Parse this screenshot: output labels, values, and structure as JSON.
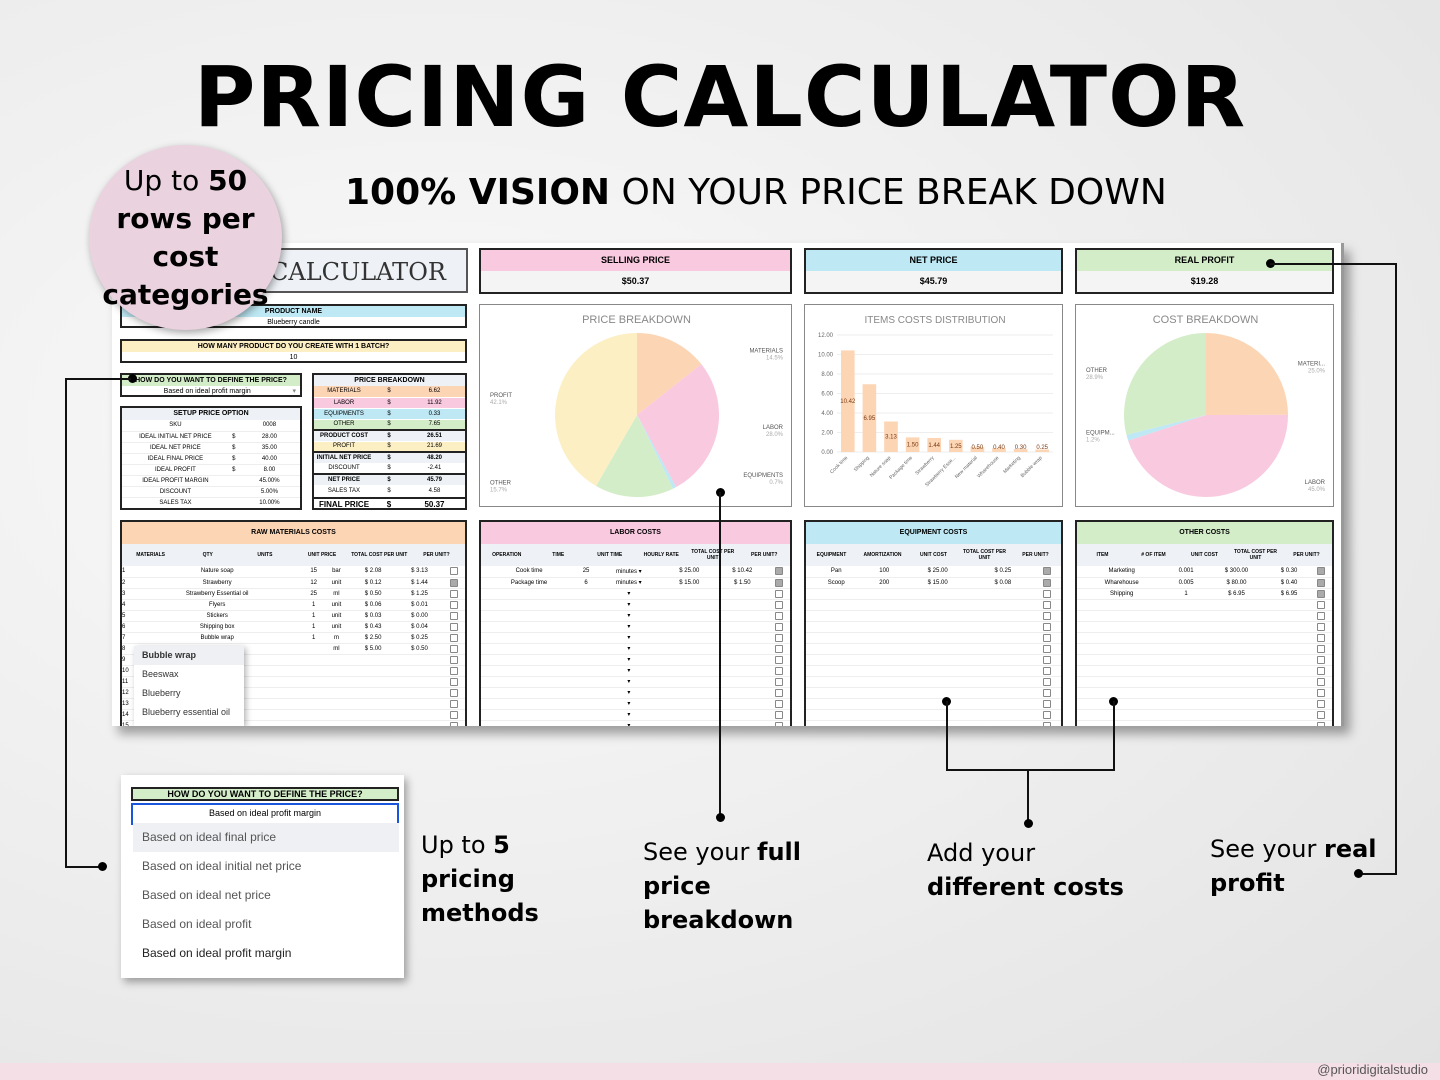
{
  "title": "PRICING CALCULATOR",
  "subtitle": {
    "bold": "100% VISION",
    "rest": " ON YOUR PRICE BREAK DOWN"
  },
  "badge": {
    "pre": "Up to ",
    "bold": "50",
    "rest": "rows per cost categories"
  },
  "sheet": {
    "calc_title": "CALCULATOR",
    "product_name_label": "PRODUCT NAME",
    "product_name": "Blueberry candle",
    "batch_label": "HOW MANY PRODUCT DO YOU CREATE WITH 1 BATCH?",
    "batch_value": "10",
    "define_label": "HOW DO YOU WANT TO DEFINE THE PRICE?",
    "define_value": "Based on ideal profit margin",
    "setup": {
      "title": "SETUP PRICE OPTION",
      "rows": [
        [
          "SKU",
          "",
          "0008"
        ],
        [
          "IDEAL INITIAL NET PRICE",
          "$",
          "28.00"
        ],
        [
          "IDEAL NET PRICE",
          "$",
          "35.00"
        ],
        [
          "IDEAL FINAL PRICE",
          "$",
          "40.00"
        ],
        [
          "IDEAL PROFIT",
          "$",
          "8.00"
        ],
        [
          "IDEAL PROFIT MARGIN",
          "",
          "45.00%"
        ],
        [
          "DISCOUNT",
          "",
          "5.00%"
        ],
        [
          "SALES TAX",
          "",
          "10.00%"
        ]
      ]
    },
    "breakdown": {
      "title": "PRICE BREAKDOWN",
      "rows": [
        {
          "label": "MATERIALS",
          "value": "6.62",
          "color": "#fcd5b5"
        },
        {
          "label": "LABOR",
          "value": "11.92",
          "color": "#f9c9e0"
        },
        {
          "label": "EQUIPMENTS",
          "value": "0.33",
          "color": "#bde8f4"
        },
        {
          "label": "OTHER",
          "value": "7.65",
          "color": "#d4edc9"
        },
        {
          "label": "PRODUCT COST",
          "value": "26.51",
          "color": "#eef2f7",
          "bold": true
        },
        {
          "label": "PROFIT",
          "value": "21.69",
          "color": "#fdefc4"
        },
        {
          "label": "INITIAL NET PRICE",
          "value": "48.20",
          "color": "#eef2f7",
          "bold": true
        },
        {
          "label": "DISCOUNT",
          "value": "-2.41",
          "color": "#ffffff"
        },
        {
          "label": "NET PRICE",
          "value": "45.79",
          "color": "#eef2f7",
          "bold": true
        },
        {
          "label": "SALES TAX",
          "value": "4.58",
          "color": "#ffffff"
        }
      ],
      "final_label": "FINAL PRICE",
      "final_value": "50.37"
    },
    "kpis": [
      {
        "label": "SELLING PRICE",
        "value": "$50.37",
        "color": "#f9c9e0"
      },
      {
        "label": "NET PRICE",
        "value": "$45.79",
        "color": "#bde8f4"
      },
      {
        "label": "REAL PROFIT",
        "value": "$19.28",
        "color": "#d4edc9"
      }
    ],
    "raw": {
      "title": "RAW MATERIALS COSTS",
      "headers": [
        "MATERIALS",
        "QTY",
        "UNITS",
        "UNIT PRICE",
        "TOTAL COST PER UNIT",
        "PER UNIT?"
      ],
      "rows": [
        [
          "1",
          "Nature soap",
          "15",
          "bar",
          "2.08",
          "3.13",
          false
        ],
        [
          "2",
          "Strawberry",
          "12",
          "unit",
          "0.12",
          "1.44",
          true
        ],
        [
          "3",
          "Strawberry Essential oil",
          "25",
          "ml",
          "0.50",
          "1.25",
          false
        ],
        [
          "4",
          "Flyers",
          "1",
          "unit",
          "0.06",
          "0.01",
          false
        ],
        [
          "5",
          "Stickers",
          "1",
          "unit",
          "0.03",
          "0.00",
          false
        ],
        [
          "6",
          "Shipping box",
          "1",
          "unit",
          "0.43",
          "0.04",
          false
        ],
        [
          "7",
          "Bubble wrap",
          "1",
          "m",
          "2.50",
          "0.25",
          false
        ],
        [
          "8",
          "",
          "",
          "ml",
          "5.00",
          "0.50",
          false
        ]
      ],
      "suggestions": [
        "Bubble wrap",
        "Beeswax",
        "Blueberry",
        "Blueberry essential oil"
      ]
    },
    "labor": {
      "title": "LABOR COSTS",
      "headers": [
        "OPERATION",
        "TIME",
        "UNIT TIME",
        "HOURLY RATE",
        "TOTAL COST PER UNIT",
        "PER UNIT?"
      ],
      "rows": [
        [
          "Cook time",
          "25",
          "minutes",
          "25.00",
          "10.42",
          true
        ],
        [
          "Package time",
          "6",
          "minutes",
          "15.00",
          "1.50",
          true
        ]
      ]
    },
    "equipment": {
      "title": "EQUIPMENT COSTS",
      "headers": [
        "EQUIPMENT",
        "AMORTIZATION",
        "UNIT COST",
        "TOTAL COST PER UNIT",
        "PER UNIT?"
      ],
      "rows": [
        [
          "Pan",
          "100",
          "25.00",
          "0.25",
          true
        ],
        [
          "Scoop",
          "200",
          "15.00",
          "0.08",
          true
        ]
      ]
    },
    "other": {
      "title": "OTHER COSTS",
      "headers": [
        "ITEM",
        "# OF ITEM",
        "UNIT COST",
        "TOTAL COST PER UNIT",
        "PER UNIT?"
      ],
      "rows": [
        [
          "Marketing",
          "0.001",
          "300.00",
          "0.30",
          true
        ],
        [
          "Wharehouse",
          "0.005",
          "80.00",
          "0.40",
          true
        ],
        [
          "Shipping",
          "1",
          "6.95",
          "6.95",
          true
        ]
      ]
    }
  },
  "chart_data": [
    {
      "type": "pie",
      "title": "PRICE BREAKDOWN",
      "labels": [
        "MATERIALS",
        "LABOR",
        "EQUIPMENTS",
        "OTHER",
        "PROFIT"
      ],
      "values": [
        14.5,
        28.0,
        0.7,
        15.7,
        42.1
      ],
      "colors": [
        "#fcd5b5",
        "#f9c9e0",
        "#bde8f4",
        "#d4edc9",
        "#fdefc4"
      ]
    },
    {
      "type": "bar",
      "title": "ITEMS COSTS DISTRIBUTION",
      "categories": [
        "Cook time",
        "Shipping",
        "Nature soap",
        "Package time",
        "Strawberry",
        "Strawberry Esse...",
        "New material",
        "Wharehouse",
        "Marketing",
        "Bubble wrap"
      ],
      "values": [
        10.42,
        6.95,
        3.13,
        1.5,
        1.44,
        1.25,
        0.5,
        0.4,
        0.3,
        0.25
      ],
      "ylim": [
        0,
        12
      ],
      "yticks": [
        "0.00",
        "2.00",
        "4.00",
        "6.00",
        "8.00",
        "10.00",
        "12.00"
      ],
      "color": "#fcd5b5"
    },
    {
      "type": "pie",
      "title": "COST BREAKDOWN",
      "labels": [
        "MATERI...",
        "LABOR",
        "EQUIPM...",
        "OTHER"
      ],
      "values": [
        25.0,
        45.0,
        1.2,
        28.9
      ],
      "colors": [
        "#fcd5b5",
        "#f9c9e0",
        "#bde8f4",
        "#d4edc9"
      ]
    }
  ],
  "popup": {
    "label": "HOW DO YOU WANT TO DEFINE THE PRICE?",
    "value": "Based on ideal profit margin",
    "options": [
      "Based on ideal final price",
      "Based on ideal initial net price",
      "Based on ideal net price",
      "Based on ideal profit",
      "Based on ideal profit margin"
    ]
  },
  "notes": [
    {
      "pre": "Up to ",
      "bold": "5 pricing",
      "post": " methods"
    },
    {
      "pre": "See your ",
      "bold": "full price breakdown",
      "post": ""
    },
    {
      "pre": "Add your ",
      "bold": "different costs",
      "post": ""
    },
    {
      "pre": "See your ",
      "bold": "real profit",
      "post": ""
    }
  ],
  "handle": "@prioridigitalstudio"
}
